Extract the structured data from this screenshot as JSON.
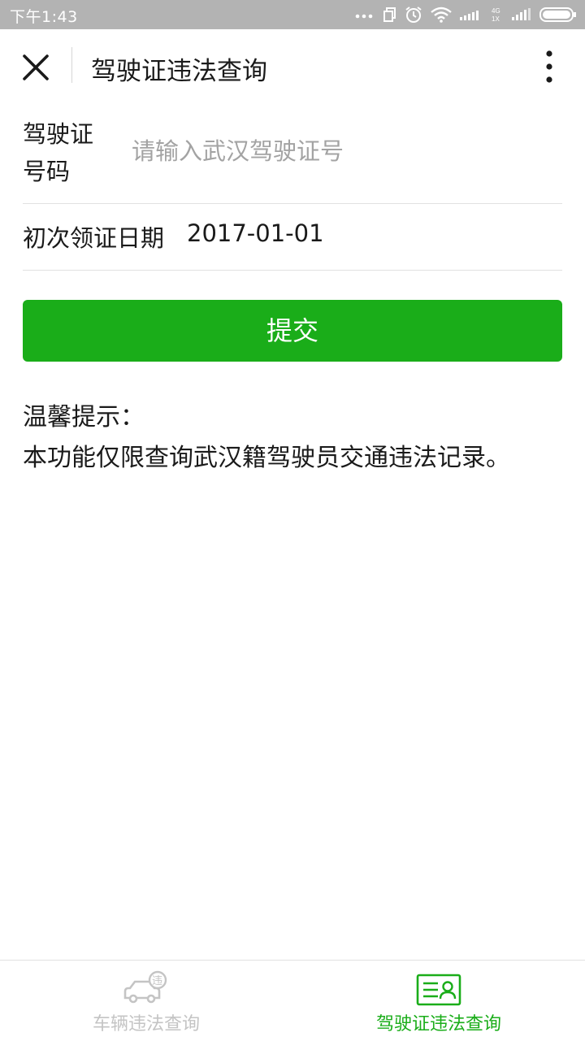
{
  "status_bar": {
    "time": "下午1:43",
    "network_label": "4G 1X",
    "icons": [
      "more-dots-icon",
      "sim-icon",
      "alarm-icon",
      "wifi-icon",
      "signal-icon",
      "battery-icon"
    ]
  },
  "header": {
    "title": "驾驶证违法查询",
    "close_icon": "close-icon",
    "more_icon": "more-vertical-icon"
  },
  "form": {
    "license_label": "驾驶证\n号码",
    "license_placeholder": "请输入武汉驾驶证号",
    "license_value": "",
    "date_label": "初次领证日期",
    "date_value": "2017-01-01"
  },
  "submit_label": "提交",
  "tips": {
    "title": "温馨提示：",
    "text": "本功能仅限查询武汉籍驾驶员交通违法记录。"
  },
  "tabbar": {
    "active_index": 1,
    "tabs": [
      {
        "label": "车辆违法查询",
        "icon": "car-violation-icon"
      },
      {
        "label": "驾驶证违法查询",
        "icon": "license-card-icon"
      }
    ]
  },
  "colors": {
    "accent": "#1aad19",
    "status_bar": "#b3b3b3",
    "inactive_tab": "#c4c4c4",
    "placeholder": "#a3a3a3"
  }
}
